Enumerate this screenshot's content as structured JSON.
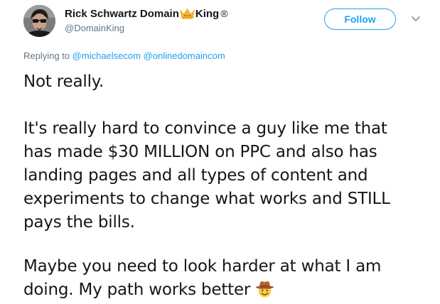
{
  "author": {
    "display_name_prefix": "Rick Schwartz Domain",
    "display_name_suffix": "King",
    "verified_mark": "®",
    "handle": "@DomainKing",
    "avatar_icon": "profile-photo",
    "crown_icon": "crown-emoji"
  },
  "actions": {
    "follow_label": "Follow",
    "more_icon": "chevron-down-icon"
  },
  "reply": {
    "prefix": "Replying to",
    "mentions": [
      "@michaelsecom",
      "@onlinedomaincom"
    ]
  },
  "tweet": {
    "paragraph1": "Not really.",
    "paragraph2_lines": [
      "It's really hard to convince a guy like me that",
      "has made $30 MILLION on PPC and also has",
      "landing pages and all types of content and",
      "experiments to change what works and STILL",
      "pays the bills."
    ],
    "paragraph3_lines": [
      "Maybe you need to look harder at what I am",
      "doing. My path works better"
    ],
    "trailing_emoji": "cowboy-hat-face-emoji"
  },
  "colors": {
    "accent": "#1da1f2",
    "text": "#14171a",
    "muted": "#657786"
  }
}
